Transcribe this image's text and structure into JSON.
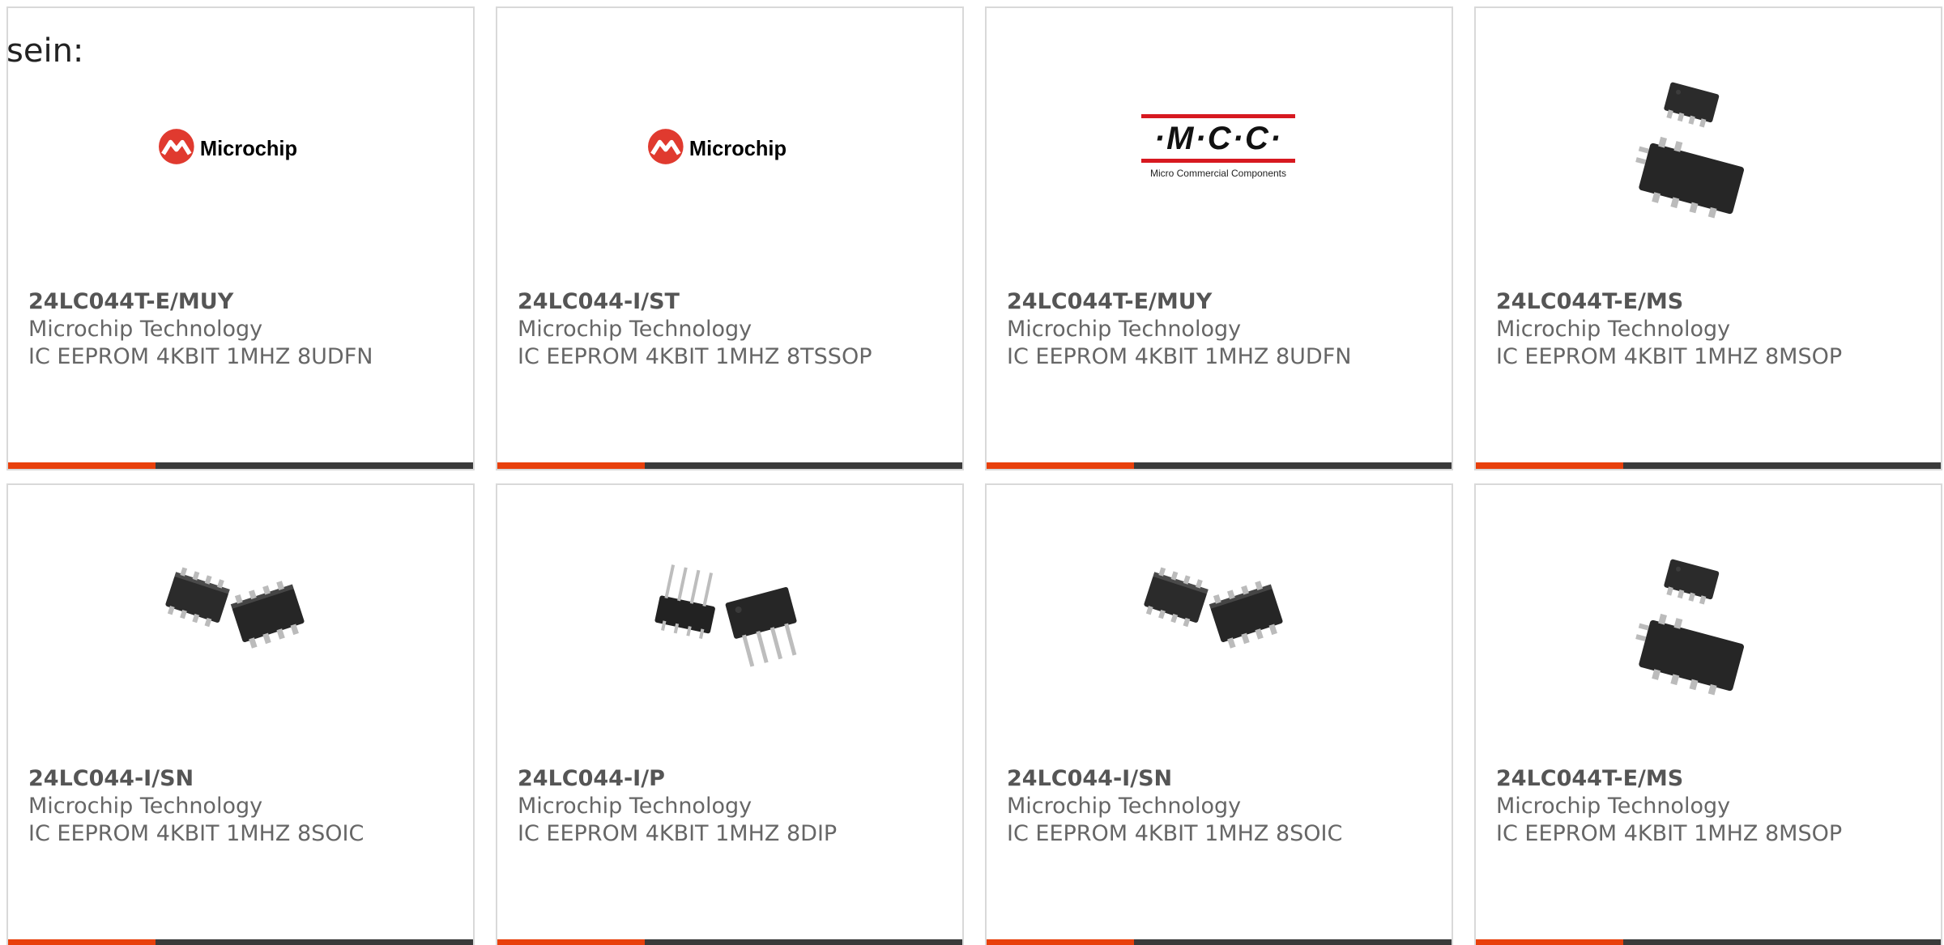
{
  "intro_text": "sein:",
  "colors": {
    "accent": "#e8400c",
    "bar": "#3a3a3a",
    "microchip_red": "#e03a2f",
    "mcc_red": "#d71920"
  },
  "cards": [
    {
      "part": "24LC044T-E/MUY",
      "manufacturer": "Microchip Technology",
      "description": "IC EEPROM 4KBIT 1MHZ 8UDFN",
      "image": "microchip-logo",
      "logo_text": "Microchip"
    },
    {
      "part": "24LC044-I/ST",
      "manufacturer": "Microchip Technology",
      "description": "IC EEPROM 4KBIT 1MHZ 8TSSOP",
      "image": "microchip-logo",
      "logo_text": "Microchip"
    },
    {
      "part": "24LC044T-E/MUY",
      "manufacturer": "Microchip Technology",
      "description": "IC EEPROM 4KBIT 1MHZ 8UDFN",
      "image": "mcc-logo",
      "logo_text": "·M·C·C·",
      "logo_subtext": "Micro Commercial Components"
    },
    {
      "part": "24LC044T-E/MS",
      "manufacturer": "Microchip Technology",
      "description": "IC EEPROM 4KBIT 1MHZ 8MSOP",
      "image": "msop-chip-icon"
    },
    {
      "part": "24LC044-I/SN",
      "manufacturer": "Microchip Technology",
      "description": "IC EEPROM 4KBIT 1MHZ 8SOIC",
      "image": "soic-chip-icon"
    },
    {
      "part": "24LC044-I/P",
      "manufacturer": "Microchip Technology",
      "description": "IC EEPROM 4KBIT 1MHZ 8DIP",
      "image": "dip-chip-icon"
    },
    {
      "part": "24LC044-I/SN",
      "manufacturer": "Microchip Technology",
      "description": "IC EEPROM 4KBIT 1MHZ 8SOIC",
      "image": "soic-chip-icon"
    },
    {
      "part": "24LC044T-E/MS",
      "manufacturer": "Microchip Technology",
      "description": "IC EEPROM 4KBIT 1MHZ 8MSOP",
      "image": "msop-chip-icon"
    }
  ]
}
